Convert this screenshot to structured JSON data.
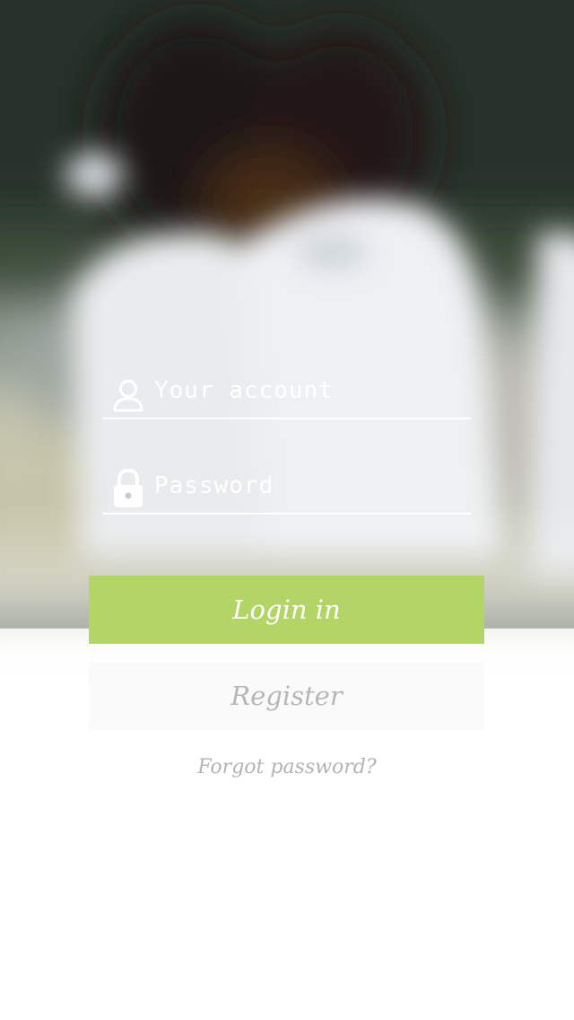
{
  "login_form": {
    "account_field": {
      "value": "",
      "placeholder": "Your account",
      "icon": "user-icon"
    },
    "password_field": {
      "value": "",
      "placeholder": "Password",
      "icon": "lock-icon"
    },
    "login_button_label": "Login in",
    "register_button_label": "Register",
    "forgot_password_label": "Forgot password?"
  },
  "colors": {
    "login_button": "#b3d566",
    "login_text": "#ffffff",
    "register_button": "#fafafa",
    "register_text": "#b6b6b6",
    "forgot_text": "#b3b3b3",
    "input_text": "#ffffff"
  }
}
